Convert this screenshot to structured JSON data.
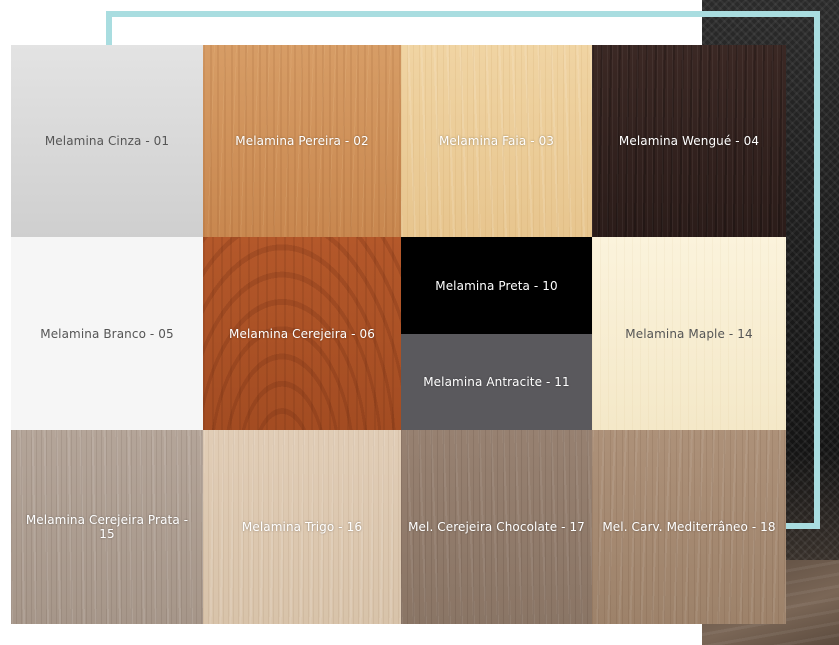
{
  "swatches": {
    "cinza": "Melamina Cinza - 01",
    "pereira": "Melamina Pereira - 02",
    "faia": "Melamina Faia - 03",
    "wengue": "Melamina Wengué - 04",
    "branco": "Melamina Branco - 05",
    "cerejeira": "Melamina Cerejeira - 06",
    "preta": "Melamina Preta - 10",
    "antracite": "Melamina Antracite - 11",
    "maple": "Melamina Maple - 14",
    "cerejeira_prata": "Melamina Cerejeira Prata - 15",
    "trigo": "Melamina Trigo - 16",
    "cerejeira_chocolate": "Mel. Cerejeira Chocolate - 17",
    "carvalho_mediterraneo": "Mel. Carv. Mediterrâneo - 18"
  },
  "colors": {
    "accent_frame": "#a9dde0",
    "cinza": "#d9d9d9",
    "pereira": "#d0925a",
    "faia": "#ecce99",
    "wengue": "#33221e",
    "branco": "#f6f6f6",
    "cerejeira": "#ad5226",
    "preta": "#000000",
    "antracite": "#5a595d",
    "maple": "#f7eed2",
    "cerejeira_prata": "#ad9d90",
    "trigo": "#dcc8b0",
    "cerejeira_chocolate": "#907b6b",
    "carvalho_mediterraneo": "#a58a72"
  }
}
